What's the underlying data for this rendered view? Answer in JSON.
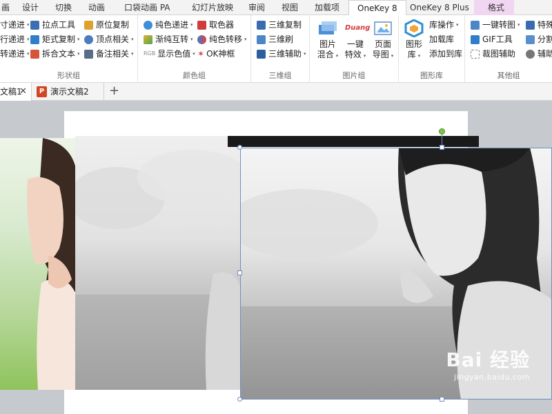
{
  "tabs": [
    "画",
    "设计",
    "切换",
    "动画",
    "口袋动画 PA",
    "幻灯片放映",
    "审阅",
    "视图",
    "加载项",
    "OneKey 8",
    "OneKey 8 Plus",
    "格式"
  ],
  "active_tab": "OneKey 8",
  "groups": {
    "shape": {
      "label": "形状组",
      "items": [
        "寸递进",
        "拉点工具",
        "原位复制",
        "行递进",
        "矩式复制",
        "顶点相关",
        "转递进",
        "拆合文本",
        "备注相关"
      ]
    },
    "color": {
      "label": "颜色组",
      "items": [
        "纯色递进",
        "取色器",
        "渐纯互转",
        "纯色转移",
        "显示色值",
        "OK神框"
      ]
    },
    "threed": {
      "label": "三维组",
      "items": [
        "三维复制",
        "三维刷",
        "三维辅助"
      ]
    },
    "image": {
      "label": "图片组",
      "buttons": [
        {
          "line1": "图片",
          "line2": "混合"
        },
        {
          "line1": "一键",
          "line2": "特效"
        },
        {
          "line1": "页面",
          "line2": "导图"
        }
      ],
      "duang": "Duang"
    },
    "library": {
      "label": "图形库",
      "big": {
        "line1": "图形",
        "line2": "库"
      },
      "items": [
        "库操作",
        "加载库",
        "添加到库"
      ]
    },
    "other": {
      "label": "其他组",
      "items": [
        "一键转图",
        "特殊",
        "GIF工具",
        "分割",
        "裁图辅助",
        "辅助"
      ]
    }
  },
  "doc_tabs": [
    {
      "label": "文稿1",
      "active": true
    },
    {
      "label": "演示文稿2",
      "active": false
    }
  ],
  "add_tab_glyph": "+",
  "close_glyph": "✕",
  "ppt_icon_letter": "P",
  "rgb_label": "RGB",
  "watermark": {
    "line1": "Bai 经验",
    "line2": "jingyan.baidu.com"
  },
  "colors": {
    "accent_onekey": "#c45fc8",
    "context_tab": "#f1d6f2",
    "selection": "#6d8fbe",
    "rotate_handle": "#7fc34a",
    "ppt_icon": "#d24625"
  }
}
